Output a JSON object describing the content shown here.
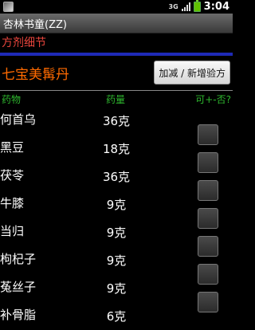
{
  "status_bar": {
    "network": "3G",
    "time": "3:04"
  },
  "app": {
    "title": "杏林书童(ZZ)"
  },
  "section": {
    "title": "方剂细节"
  },
  "recipe": {
    "name": "七宝美髯丹",
    "edit_button": "加减 / 新增验方"
  },
  "columns": {
    "herb": "药物",
    "dose": "药量",
    "option": "可+-否?"
  },
  "herbs": [
    {
      "name": "何首乌",
      "dose": "36克"
    },
    {
      "name": "黑豆",
      "dose": "18克"
    },
    {
      "name": "茯苓",
      "dose": "36克"
    },
    {
      "name": "牛膝",
      "dose": "9克"
    },
    {
      "name": "当归",
      "dose": "9克"
    },
    {
      "name": "枸杞子",
      "dose": "9克"
    },
    {
      "name": "菟丝子",
      "dose": "9克"
    },
    {
      "name": "补骨脂",
      "dose": "6克"
    }
  ],
  "colors": {
    "section_title": "#e8453c",
    "recipe_name": "#ff6a00",
    "column_header": "#2eb82e",
    "rule_blue": "#1e2ab6"
  },
  "icons": {
    "notification": "image-icon",
    "signal": "signal-bars-icon",
    "battery": "battery-charging-icon"
  }
}
